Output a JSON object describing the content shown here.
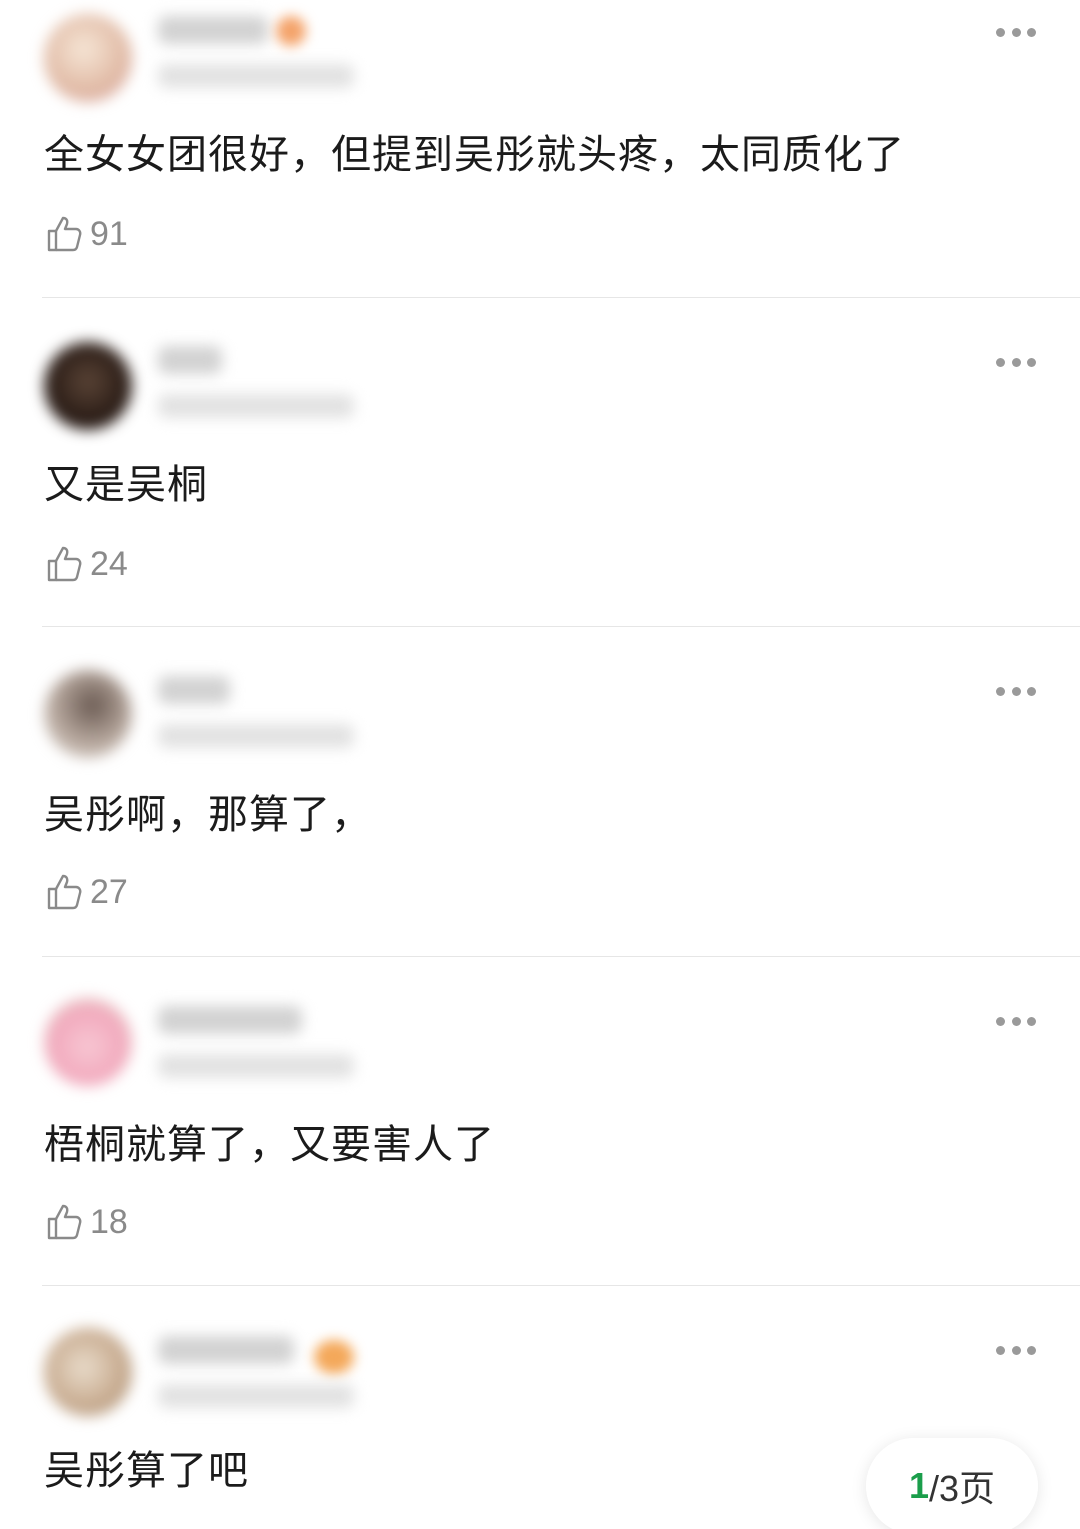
{
  "comments": [
    {
      "text": "全女女团很好，但提到吴彤就头疼，太同质化了",
      "likes": "91",
      "avatar_color": "#e6c9b8",
      "emoji_color": "#f4a36a"
    },
    {
      "text": "又是吴桐",
      "likes": "24",
      "avatar_color": "#3a2a22"
    },
    {
      "text": "吴彤啊，那算了，",
      "likes": "27",
      "avatar_color": "#9a8a80"
    },
    {
      "text": "梧桐就算了，又要害人了",
      "likes": "18",
      "avatar_color": "#f2b9c8"
    },
    {
      "text": "吴彤算了吧",
      "avatar_color": "#c9b39a",
      "emoji_color": "#f4a85a"
    }
  ],
  "pager": {
    "current": "1",
    "rest": "/3页"
  },
  "colors": {
    "text": "#1b1b1b",
    "like_count": "#8a8a8a",
    "divider": "#e6e6e6",
    "pager_current": "#1b9e4b"
  }
}
